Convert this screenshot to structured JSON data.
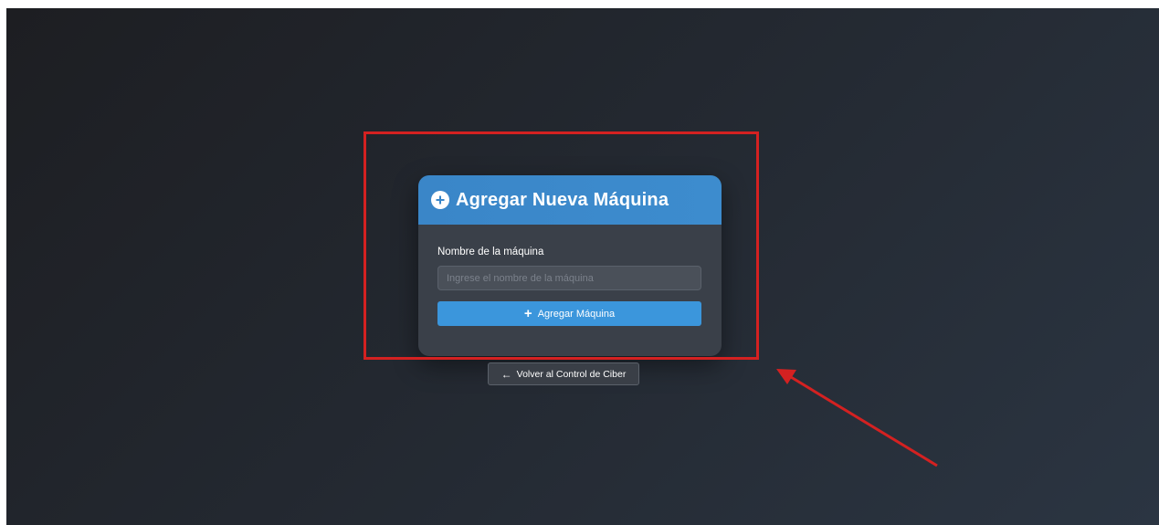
{
  "card": {
    "title": "Agregar Nueva Máquina",
    "header_icon": "plus-circle-icon",
    "field_label": "Nombre de la máquina",
    "input_placeholder": "Ingrese el nombre de la máquina",
    "input_value": "",
    "submit_label": "Agregar Máquina",
    "submit_icon": "plus-icon"
  },
  "back_button": {
    "label": "Volver al Control de Ciber",
    "icon": "arrow-left-icon"
  },
  "colors": {
    "header_blue": "#3a86c8",
    "button_blue": "#3b96dc",
    "card_bg": "#3a4049",
    "annotation_red": "#d42121"
  }
}
